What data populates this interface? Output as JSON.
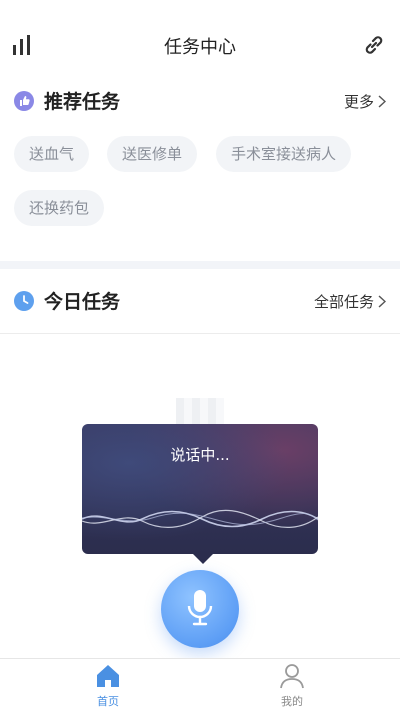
{
  "header": {
    "title": "任务中心",
    "left_icon": "bar-chart-icon",
    "right_icon": "link-icon"
  },
  "recommended": {
    "title": "推荐任务",
    "more_label": "更多",
    "icon": "thumbs-up-icon",
    "tasks": [
      "送血气",
      "送医修单",
      "手术室接送病人",
      "还换药包"
    ]
  },
  "today": {
    "title": "今日任务",
    "all_label": "全部任务",
    "icon": "clock-icon"
  },
  "voice": {
    "status_text": "说话中..."
  },
  "tabbar": {
    "items": [
      {
        "label": "首页",
        "icon": "home-icon",
        "active": true
      },
      {
        "label": "我的",
        "icon": "user-icon",
        "active": false
      }
    ]
  },
  "colors": {
    "accent": "#4a90e2",
    "recommend_icon_bg": "#8a88e6",
    "today_icon_bg": "#5ea0ee",
    "chip_bg": "#f2f4f7",
    "chip_text": "#8a8f99"
  }
}
